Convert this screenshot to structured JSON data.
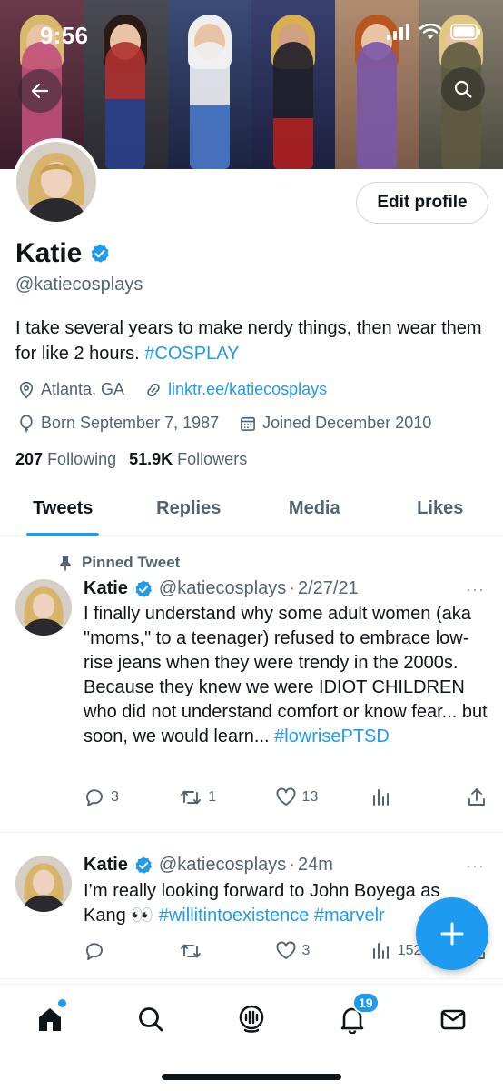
{
  "status": {
    "time": "9:56"
  },
  "colors": {
    "accent": "#1d9bf0",
    "text": "#0f1419",
    "secondary": "#536471"
  },
  "profile": {
    "edit_label": "Edit profile",
    "name": "Katie",
    "handle": "@katiecosplays",
    "bio_text": "I take several years to make nerdy things, then wear them for like 2 hours. ",
    "bio_tag": "#COSPLAY",
    "location": "Atlanta, GA",
    "link": "linktr.ee/katiecosplays",
    "born": "Born September 7, 1987",
    "joined": "Joined December 2010",
    "following_count": "207",
    "following_label": "Following",
    "followers_count": "51.9K",
    "followers_label": "Followers"
  },
  "tabs": [
    {
      "label": "Tweets",
      "active": true
    },
    {
      "label": "Replies"
    },
    {
      "label": "Media"
    },
    {
      "label": "Likes"
    }
  ],
  "tweets": [
    {
      "pinned_label": "Pinned Tweet",
      "name": "Katie",
      "handle": "@katiecosplays",
      "sep": "·",
      "time": "2/27/21",
      "more": "···",
      "text": "I finally understand why some adult women (aka \"moms,\" to a teenager) refused to embrace low-rise jeans when they were trendy in the 2000s. Because they knew we were IDIOT CHILDREN who did not understand comfort or know fear... but soon, we would learn... ",
      "tag": "#lowrisePTSD",
      "replies": "3",
      "retweets": "1",
      "likes": "13"
    },
    {
      "name": "Katie",
      "handle": "@katiecosplays",
      "sep": "·",
      "time": "24m",
      "more": "···",
      "text": "I’m really looking forward to John Boyega as Kang 👀 ",
      "tag": "#willitintoexistence #marvelr",
      "replies": "",
      "retweets": "",
      "likes": "3",
      "views": "152"
    }
  ],
  "nav": {
    "notifications_badge": "19"
  },
  "banner_colors": [
    "#5a2838",
    "#3a3a44",
    "#3d4a6a",
    "#2a3150",
    "#8c6a58",
    "#6f6a5a"
  ]
}
